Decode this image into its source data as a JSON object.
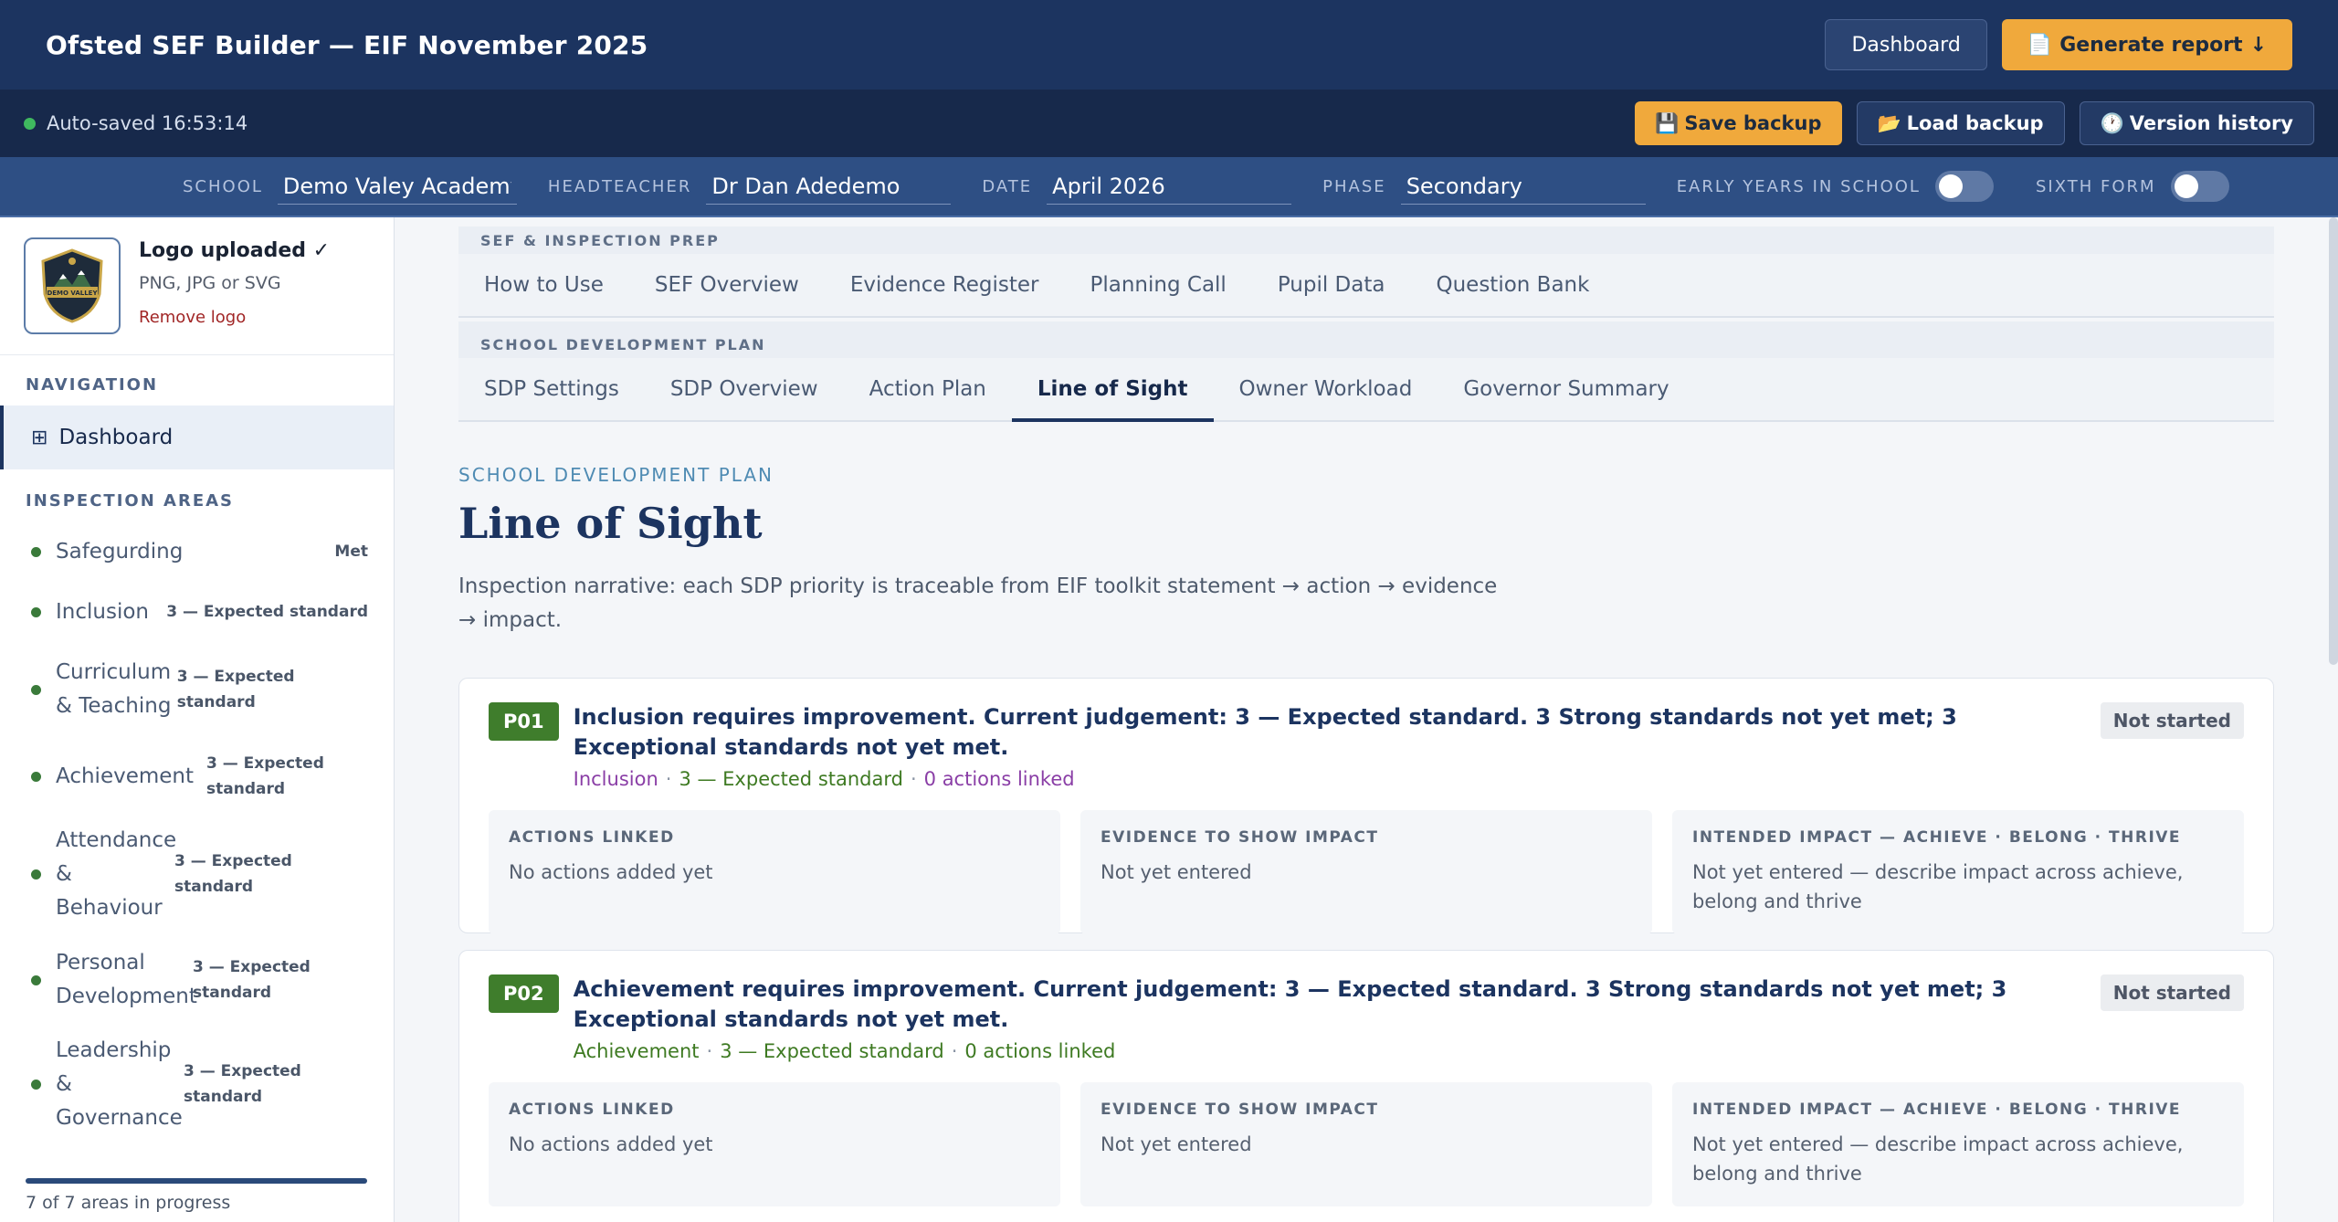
{
  "app": {
    "title": "Ofsted SEF Builder — EIF November 2025",
    "dashboard_label": "Dashboard",
    "generate_label": "Generate report",
    "generate_icon": "document-icon",
    "generate_arrow": "↓"
  },
  "status": {
    "autosave": "Auto-saved 16:53:14",
    "save_backup": "Save backup",
    "load_backup": "Load backup",
    "version_history": "Version history"
  },
  "meta": {
    "school_label": "SCHOOL",
    "school_value": "Demo Valey Academy",
    "headteacher_label": "HEADTEACHER",
    "headteacher_value": "Dr Dan Adedemo",
    "date_label": "DATE",
    "date_value": "April 2026",
    "phase_label": "PHASE",
    "phase_value": "Secondary",
    "early_years_label": "EARLY YEARS IN SCHOOL",
    "early_years_on": false,
    "sixth_form_label": "SIXTH FORM",
    "sixth_form_on": false
  },
  "sidebar": {
    "logo_status": "Logo uploaded ✓",
    "logo_hint": "PNG, JPG or SVG",
    "logo_remove": "Remove logo",
    "logo_text": "DEMO VALLEY",
    "nav_heading": "NAVIGATION",
    "dashboard_label": "Dashboard",
    "areas_heading": "INSPECTION AREAS",
    "areas": [
      {
        "name": "Safegurding",
        "badge": "Met"
      },
      {
        "name": "Inclusion",
        "badge": "3 — Expected standard"
      },
      {
        "name": "Curriculum & Teaching",
        "badge": "3 — Expected standard"
      },
      {
        "name": "Achievement",
        "badge": "3 — Expected standard"
      },
      {
        "name": "Attendance & Behaviour",
        "badge": "3 — Expected standard"
      },
      {
        "name": "Personal Development",
        "badge": "3 — Expected standard"
      },
      {
        "name": "Leadership & Governance",
        "badge": "3 — Expected standard"
      }
    ],
    "progress_fraction": 1.0,
    "progress_text": "7 of 7 areas in progress"
  },
  "tabs": {
    "group1_label": "SEF & INSPECTION PREP",
    "group1": [
      "How to Use",
      "SEF Overview",
      "Evidence Register",
      "Planning Call",
      "Pupil Data",
      "Question Bank"
    ],
    "group2_label": "SCHOOL DEVELOPMENT PLAN",
    "group2": [
      "SDP Settings",
      "SDP Overview",
      "Action Plan",
      "Line of Sight",
      "Owner Workload",
      "Governor Summary"
    ],
    "active": "Line of Sight"
  },
  "page": {
    "eyebrow": "SCHOOL DEVELOPMENT PLAN",
    "title": "Line of Sight",
    "description": "Inspection narrative: each SDP priority is traceable from EIF toolkit statement → action → evidence → impact."
  },
  "priorities": [
    {
      "id": "P01",
      "title": "Inclusion requires improvement. Current judgement: 3 — Expected standard. 3 Strong standards not yet met; 3 Exceptional standards not yet met.",
      "area": "Inclusion",
      "judgement": "3 — Expected standard",
      "actions_linked": "0 actions linked",
      "status": "Not started",
      "col1_label": "ACTIONS LINKED",
      "col1_value": "No actions added yet",
      "col2_label": "EVIDENCE TO SHOW IMPACT",
      "col2_value": "Not yet entered",
      "col3_label": "INTENDED IMPACT — ACHIEVE · BELONG · THRIVE",
      "col3_value": "Not yet entered — describe impact across achieve, belong and thrive"
    },
    {
      "id": "P02",
      "title": "Achievement requires improvement. Current judgement: 3 — Expected standard. 3 Strong standards not yet met; 3 Exceptional standards not yet met.",
      "area": "Achievement",
      "judgement": "3 — Expected standard",
      "actions_linked": "0 actions linked",
      "status": "Not started",
      "col1_label": "ACTIONS LINKED",
      "col1_value": "No actions added yet",
      "col2_label": "EVIDENCE TO SHOW IMPACT",
      "col2_value": "Not yet entered",
      "col3_label": "INTENDED IMPACT — ACHIEVE · BELONG · THRIVE",
      "col3_value": "Not yet entered — describe impact across achieve, belong and thrive"
    }
  ],
  "colors": {
    "header_bg": "#1c3460",
    "accent_gold": "#f0a93c",
    "status_green": "#3fb95f",
    "priority_green": "#3f7d2c",
    "area_purple": "#8a3ea6"
  }
}
